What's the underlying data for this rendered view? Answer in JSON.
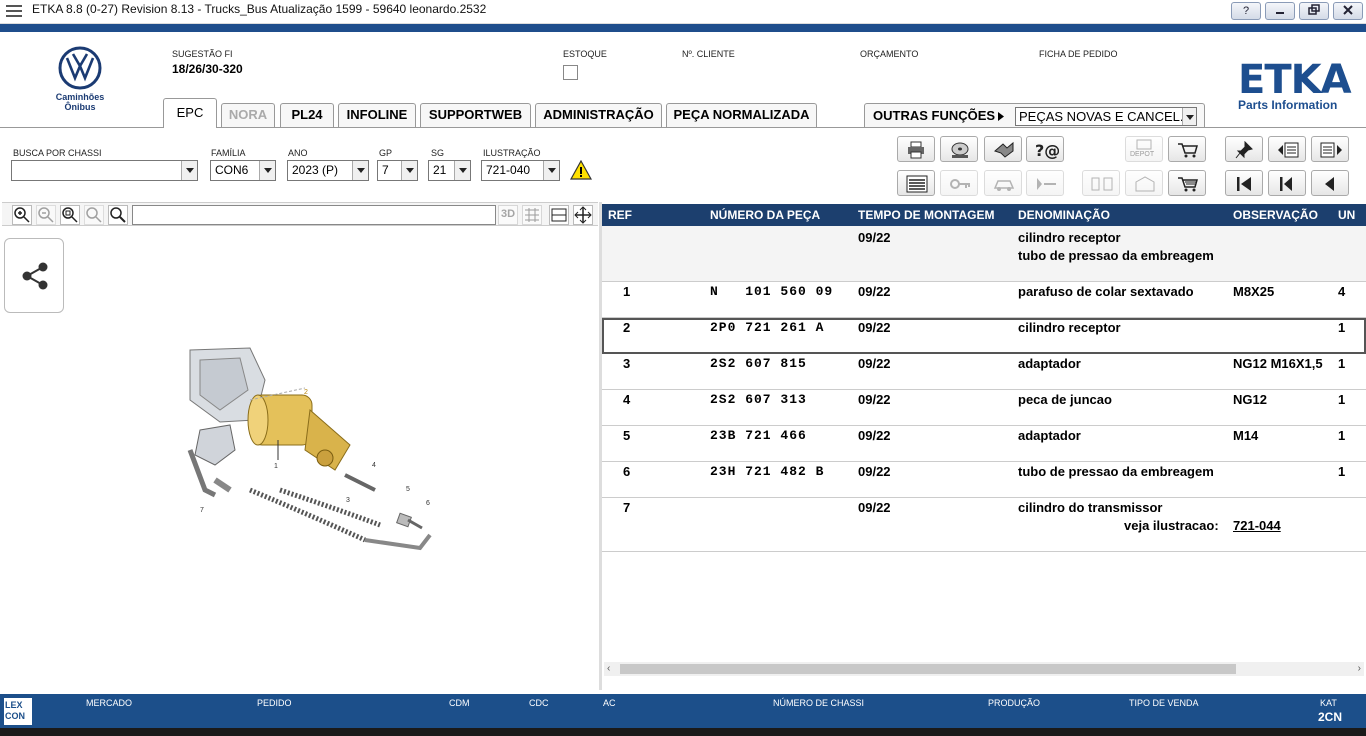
{
  "window": {
    "title": "ETKA 8.8 (0-27) Revision 8.13 - Trucks_Bus Atualização 1599 - 59640 leonardo.2532",
    "help_label": "?"
  },
  "brand": {
    "line1": "Caminhões",
    "line2": "Ônibus",
    "etka": "ETKA",
    "etka_sub": "Parts Information",
    "accent": "#1d4e8f"
  },
  "header": {
    "sugestao_label": "SUGESTÃO FI",
    "sugestao_value": "18/26/30-320",
    "estoque_label": "ESTOQUE",
    "cliente_label": "Nº. CLIENTE",
    "orcamento_label": "ORÇAMENTO",
    "ficha_label": "FICHA DE PEDIDO"
  },
  "tabs": [
    {
      "label": "EPC"
    },
    {
      "label": "NORA"
    },
    {
      "label": "PL24"
    },
    {
      "label": "INFOLINE"
    },
    {
      "label": "SUPPORTWEB"
    },
    {
      "label": "ADMINISTRAÇÃO"
    },
    {
      "label": "PEÇA NORMALIZADA"
    }
  ],
  "outras": {
    "label": "OUTRAS FUNÇÕES",
    "selected": "PEÇAS NOVAS E CANCEL."
  },
  "filters": {
    "chassi_label": "BUSCA POR CHASSI",
    "chassi_value": "",
    "familia_label": "FAMÍLIA",
    "familia_value": "CON6",
    "ano_label": "ANO",
    "ano_value": "2023 (P)",
    "gp_label": "GP",
    "gp_value": "7",
    "sg_label": "SG",
    "sg_value": "21",
    "ilustracao_label": "ILUSTRAÇÃO",
    "ilustracao_value": "721-040"
  },
  "toolbar": {
    "depot_label": "DEPOT",
    "threed_label": "3D"
  },
  "table": {
    "headers": {
      "ref": "REF",
      "numero": "NÚMERO DA PEÇA",
      "tempo": "TEMPO DE MONTAGEM",
      "denominacao": "DENOMINAÇÃO",
      "observacao": "OBSERVAÇÃO",
      "un": "UN"
    },
    "header_row": {
      "tempo": "09/22",
      "denom1": "cilindro receptor",
      "denom2": "tubo de pressao da embreagem"
    },
    "rows": [
      {
        "ref": "1",
        "numero": "N   101 560 09",
        "tempo": "09/22",
        "denominacao": "parafuso de colar sextavado",
        "observacao": "M8X25",
        "un": "4"
      },
      {
        "ref": "2",
        "numero": "2P0 721 261 A",
        "tempo": "09/22",
        "denominacao": "cilindro receptor",
        "observacao": "",
        "un": "1"
      },
      {
        "ref": "3",
        "numero": "2S2 607 815",
        "tempo": "09/22",
        "denominacao": "adaptador",
        "observacao": "NG12 M16X1,5",
        "un": "1"
      },
      {
        "ref": "4",
        "numero": "2S2 607 313",
        "tempo": "09/22",
        "denominacao": "peca de juncao",
        "observacao": "NG12",
        "un": "1"
      },
      {
        "ref": "5",
        "numero": "23B 721 466",
        "tempo": "09/22",
        "denominacao": "adaptador",
        "observacao": "M14",
        "un": "1"
      },
      {
        "ref": "6",
        "numero": "23H 721 482 B",
        "tempo": "09/22",
        "denominacao": "tubo de pressao da embreagem",
        "observacao": "",
        "un": "1"
      },
      {
        "ref": "7",
        "numero": "",
        "tempo": "09/22",
        "denominacao": "cilindro do transmissor",
        "observacao": "",
        "un": ""
      }
    ],
    "row7_note_label": "veja ilustracao:",
    "row7_note_link": "721-044"
  },
  "illustration": {
    "callouts": [
      "1",
      "2",
      "3",
      "4",
      "5",
      "6",
      "7"
    ]
  },
  "statusbar": {
    "lexcon": "LEX CON",
    "mercado": "MERCADO",
    "pedido": "PEDIDO",
    "cdm": "CDM",
    "cdc": "CDC",
    "ac": "AC",
    "chassi": "NÚMERO DE CHASSI",
    "producao": "PRODUÇÃO",
    "tipo": "TIPO DE VENDA",
    "kat_label": "KAT",
    "kat_value": "2CN"
  }
}
